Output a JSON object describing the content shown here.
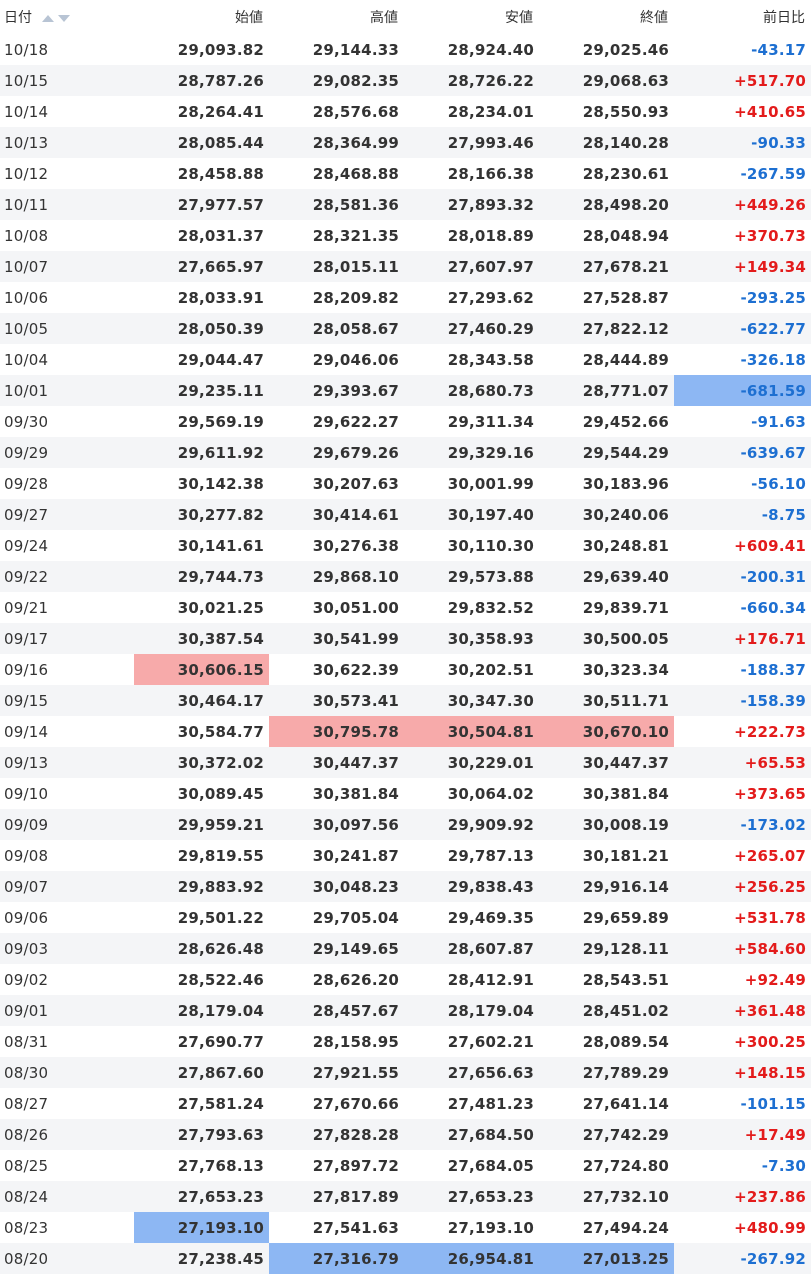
{
  "headers": {
    "date": "日付",
    "open": "始値",
    "high": "高値",
    "low": "安値",
    "close": "終値",
    "change": "前日比"
  },
  "colors": {
    "positive": "#e31b1b",
    "negative": "#1d6fd1",
    "highlight_high": "#f7aaaa",
    "highlight_low": "#8db7f3"
  },
  "rows": [
    {
      "date": "10/18",
      "open": "29,093.82",
      "high": "29,144.33",
      "low": "28,924.40",
      "close": "29,025.46",
      "change": "-43.17"
    },
    {
      "date": "10/15",
      "open": "28,787.26",
      "high": "29,082.35",
      "low": "28,726.22",
      "close": "29,068.63",
      "change": "+517.70"
    },
    {
      "date": "10/14",
      "open": "28,264.41",
      "high": "28,576.68",
      "low": "28,234.01",
      "close": "28,550.93",
      "change": "+410.65"
    },
    {
      "date": "10/13",
      "open": "28,085.44",
      "high": "28,364.99",
      "low": "27,993.46",
      "close": "28,140.28",
      "change": "-90.33"
    },
    {
      "date": "10/12",
      "open": "28,458.88",
      "high": "28,468.88",
      "low": "28,166.38",
      "close": "28,230.61",
      "change": "-267.59"
    },
    {
      "date": "10/11",
      "open": "27,977.57",
      "high": "28,581.36",
      "low": "27,893.32",
      "close": "28,498.20",
      "change": "+449.26"
    },
    {
      "date": "10/08",
      "open": "28,031.37",
      "high": "28,321.35",
      "low": "28,018.89",
      "close": "28,048.94",
      "change": "+370.73"
    },
    {
      "date": "10/07",
      "open": "27,665.97",
      "high": "28,015.11",
      "low": "27,607.97",
      "close": "27,678.21",
      "change": "+149.34"
    },
    {
      "date": "10/06",
      "open": "28,033.91",
      "high": "28,209.82",
      "low": "27,293.62",
      "close": "27,528.87",
      "change": "-293.25"
    },
    {
      "date": "10/05",
      "open": "28,050.39",
      "high": "28,058.67",
      "low": "27,460.29",
      "close": "27,822.12",
      "change": "-622.77"
    },
    {
      "date": "10/04",
      "open": "29,044.47",
      "high": "29,046.06",
      "low": "28,343.58",
      "close": "28,444.89",
      "change": "-326.18"
    },
    {
      "date": "10/01",
      "open": "29,235.11",
      "high": "29,393.67",
      "low": "28,680.73",
      "close": "28,771.07",
      "change": "-681.59",
      "hl": {
        "change": "low"
      }
    },
    {
      "date": "09/30",
      "open": "29,569.19",
      "high": "29,622.27",
      "low": "29,311.34",
      "close": "29,452.66",
      "change": "-91.63"
    },
    {
      "date": "09/29",
      "open": "29,611.92",
      "high": "29,679.26",
      "low": "29,329.16",
      "close": "29,544.29",
      "change": "-639.67"
    },
    {
      "date": "09/28",
      "open": "30,142.38",
      "high": "30,207.63",
      "low": "30,001.99",
      "close": "30,183.96",
      "change": "-56.10"
    },
    {
      "date": "09/27",
      "open": "30,277.82",
      "high": "30,414.61",
      "low": "30,197.40",
      "close": "30,240.06",
      "change": "-8.75"
    },
    {
      "date": "09/24",
      "open": "30,141.61",
      "high": "30,276.38",
      "low": "30,110.30",
      "close": "30,248.81",
      "change": "+609.41"
    },
    {
      "date": "09/22",
      "open": "29,744.73",
      "high": "29,868.10",
      "low": "29,573.88",
      "close": "29,639.40",
      "change": "-200.31"
    },
    {
      "date": "09/21",
      "open": "30,021.25",
      "high": "30,051.00",
      "low": "29,832.52",
      "close": "29,839.71",
      "change": "-660.34"
    },
    {
      "date": "09/17",
      "open": "30,387.54",
      "high": "30,541.99",
      "low": "30,358.93",
      "close": "30,500.05",
      "change": "+176.71"
    },
    {
      "date": "09/16",
      "open": "30,606.15",
      "high": "30,622.39",
      "low": "30,202.51",
      "close": "30,323.34",
      "change": "-188.37",
      "hl": {
        "open": "high"
      }
    },
    {
      "date": "09/15",
      "open": "30,464.17",
      "high": "30,573.41",
      "low": "30,347.30",
      "close": "30,511.71",
      "change": "-158.39"
    },
    {
      "date": "09/14",
      "open": "30,584.77",
      "high": "30,795.78",
      "low": "30,504.81",
      "close": "30,670.10",
      "change": "+222.73",
      "hl": {
        "high": "high",
        "low": "high",
        "close": "high"
      }
    },
    {
      "date": "09/13",
      "open": "30,372.02",
      "high": "30,447.37",
      "low": "30,229.01",
      "close": "30,447.37",
      "change": "+65.53"
    },
    {
      "date": "09/10",
      "open": "30,089.45",
      "high": "30,381.84",
      "low": "30,064.02",
      "close": "30,381.84",
      "change": "+373.65"
    },
    {
      "date": "09/09",
      "open": "29,959.21",
      "high": "30,097.56",
      "low": "29,909.92",
      "close": "30,008.19",
      "change": "-173.02"
    },
    {
      "date": "09/08",
      "open": "29,819.55",
      "high": "30,241.87",
      "low": "29,787.13",
      "close": "30,181.21",
      "change": "+265.07"
    },
    {
      "date": "09/07",
      "open": "29,883.92",
      "high": "30,048.23",
      "low": "29,838.43",
      "close": "29,916.14",
      "change": "+256.25"
    },
    {
      "date": "09/06",
      "open": "29,501.22",
      "high": "29,705.04",
      "low": "29,469.35",
      "close": "29,659.89",
      "change": "+531.78"
    },
    {
      "date": "09/03",
      "open": "28,626.48",
      "high": "29,149.65",
      "low": "28,607.87",
      "close": "29,128.11",
      "change": "+584.60"
    },
    {
      "date": "09/02",
      "open": "28,522.46",
      "high": "28,626.20",
      "low": "28,412.91",
      "close": "28,543.51",
      "change": "+92.49"
    },
    {
      "date": "09/01",
      "open": "28,179.04",
      "high": "28,457.67",
      "low": "28,179.04",
      "close": "28,451.02",
      "change": "+361.48"
    },
    {
      "date": "08/31",
      "open": "27,690.77",
      "high": "28,158.95",
      "low": "27,602.21",
      "close": "28,089.54",
      "change": "+300.25"
    },
    {
      "date": "08/30",
      "open": "27,867.60",
      "high": "27,921.55",
      "low": "27,656.63",
      "close": "27,789.29",
      "change": "+148.15"
    },
    {
      "date": "08/27",
      "open": "27,581.24",
      "high": "27,670.66",
      "low": "27,481.23",
      "close": "27,641.14",
      "change": "-101.15"
    },
    {
      "date": "08/26",
      "open": "27,793.63",
      "high": "27,828.28",
      "low": "27,684.50",
      "close": "27,742.29",
      "change": "+17.49"
    },
    {
      "date": "08/25",
      "open": "27,768.13",
      "high": "27,897.72",
      "low": "27,684.05",
      "close": "27,724.80",
      "change": "-7.30"
    },
    {
      "date": "08/24",
      "open": "27,653.23",
      "high": "27,817.89",
      "low": "27,653.23",
      "close": "27,732.10",
      "change": "+237.86"
    },
    {
      "date": "08/23",
      "open": "27,193.10",
      "high": "27,541.63",
      "low": "27,193.10",
      "close": "27,494.24",
      "change": "+480.99",
      "hl": {
        "open": "low"
      }
    },
    {
      "date": "08/20",
      "open": "27,238.45",
      "high": "27,316.79",
      "low": "26,954.81",
      "close": "27,013.25",
      "change": "-267.92",
      "hl": {
        "high": "low",
        "low": "low",
        "close": "low"
      }
    }
  ]
}
